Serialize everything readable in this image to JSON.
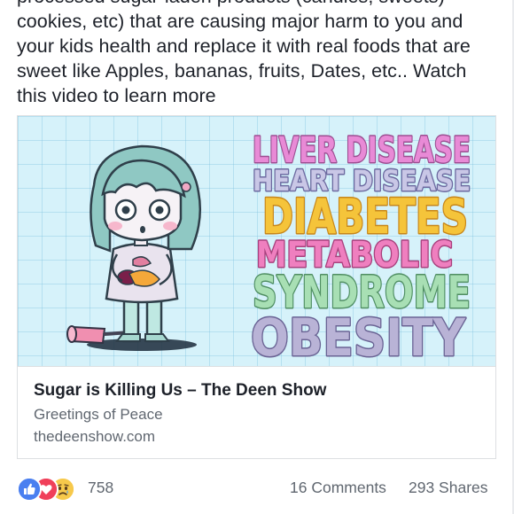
{
  "post": {
    "text_lines": [
      "processed sugar-laden products (candies, sweets)",
      "cookies, etc) that are causing major harm to you and",
      "your kids health and replace it with real foods that are",
      "sweet like Apples, bananas, fruits, Dates, etc.. Watch",
      "this video to learn more"
    ]
  },
  "link_preview": {
    "image": {
      "words": [
        "LIVER DISEASE",
        "HEART DISEASE",
        "DIABETES",
        "METABOLIC",
        "SYNDROME",
        "OBESITY"
      ]
    },
    "title": "Sugar is Killing Us – The Deen Show",
    "description": "Greetings of Peace",
    "domain": "thedeenshow.com"
  },
  "reactions": {
    "icons": [
      "like-icon",
      "love-icon",
      "sad-icon"
    ],
    "count": "758",
    "comments": "16 Comments",
    "shares": "293 Shares"
  },
  "colors": {
    "like": "#4a7ff0",
    "love": "#f0405a",
    "sad": "#f7c94b",
    "liver_disease": "#e88ad6",
    "heart_disease": "#a6a6d2",
    "diabetes": "#f5c43a",
    "metabolic": "#ef7fbf",
    "syndrome": "#a8dfb4",
    "obesity": "#a9a2c8"
  }
}
